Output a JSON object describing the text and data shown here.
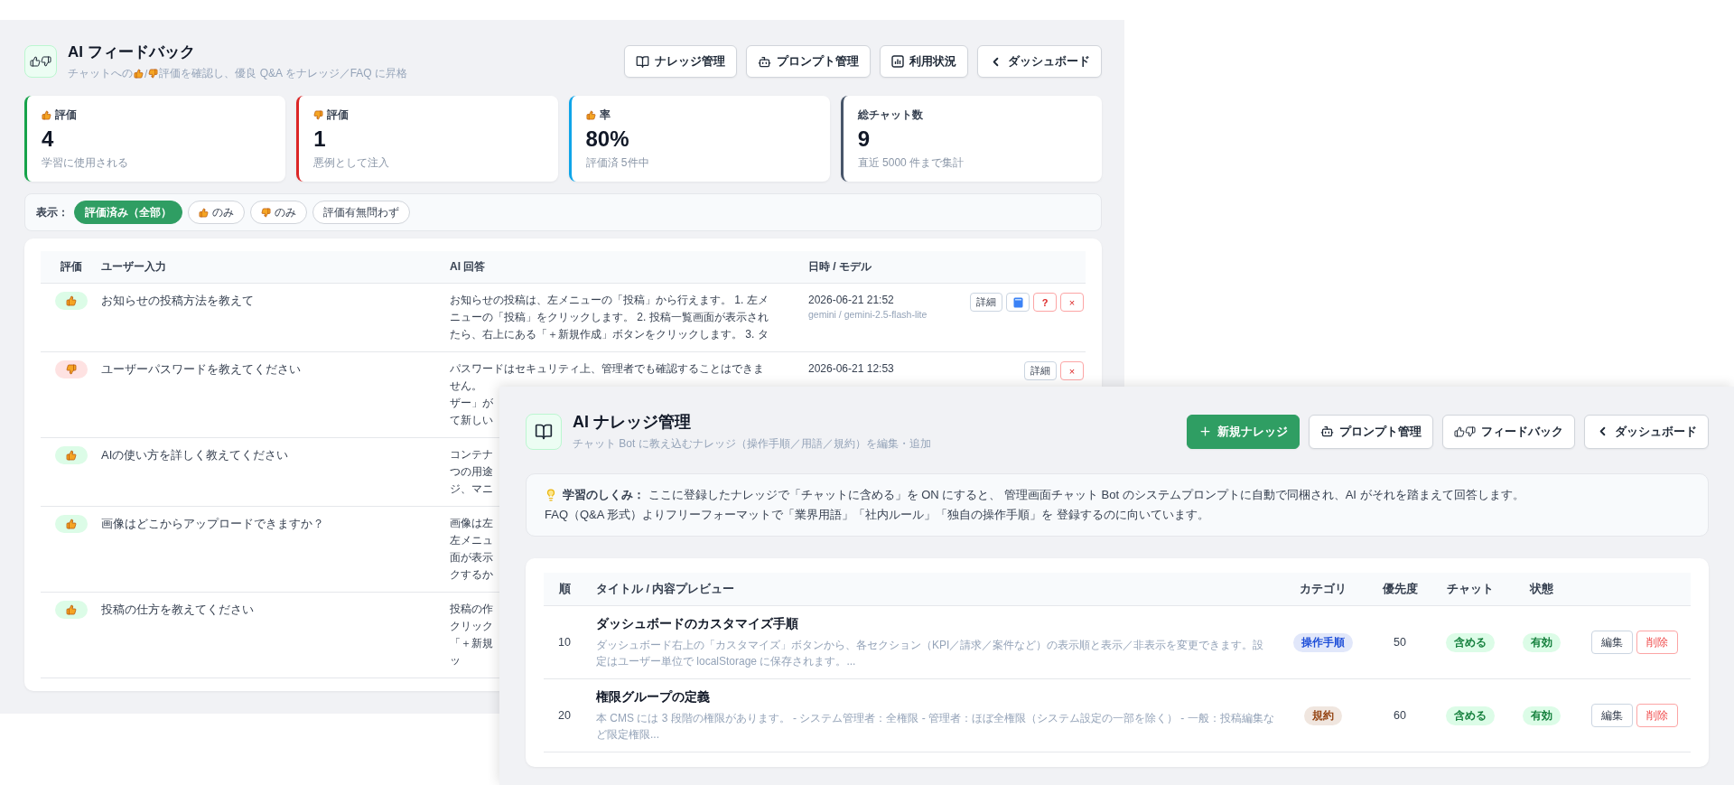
{
  "feedback_window": {
    "title": "AI フィードバック",
    "subtitle": {
      "before": "チャットへの",
      "between": "/",
      "after": "評価を確認し、優良 Q&A をナレッジ／FAQ に昇格"
    },
    "nav_buttons": [
      {
        "kind": "book",
        "label": "ナレッジ管理"
      },
      {
        "kind": "bot",
        "label": "プロンプト管理"
      },
      {
        "kind": "chart",
        "label": "利用状況"
      },
      {
        "kind": "back",
        "label": "ダッシュボード"
      }
    ],
    "stats": [
      {
        "kind": "positive",
        "label": "評価",
        "value": "4",
        "note": "学習に使用される",
        "color": "#16a34a"
      },
      {
        "kind": "negative",
        "label": "評価",
        "value": "1",
        "note": "悪例として注入",
        "color": "#dc2626"
      },
      {
        "kind": "positive",
        "label": "率",
        "value": "80%",
        "note": "評価済 5件中",
        "color": "#0ea5e9"
      },
      {
        "kind": "plain",
        "label": "総チャット数",
        "value": "9",
        "note": "直近 5000 件まで集計",
        "color": "#475569"
      }
    ],
    "filter": {
      "label": "表示：",
      "chips": [
        {
          "kind": "plain",
          "label": "評価済み（全部）",
          "selected": true
        },
        {
          "kind": "positive",
          "label": "のみ",
          "selected": false
        },
        {
          "kind": "negative",
          "label": "のみ",
          "selected": false
        },
        {
          "kind": "plain",
          "label": "評価有無問わず",
          "selected": false
        }
      ]
    },
    "table": {
      "columns": [
        "評価",
        "ユーザー入力",
        "AI 回答",
        "日時 / モデル"
      ],
      "rows": [
        {
          "positive": true,
          "question": "お知らせの投稿方法を教えて",
          "answer_lines": [
            "お知らせの投稿は、左メニューの「投稿」から行えます。 1. 左メ",
            "ニューの「投稿」をクリックします。 2. 投稿一覧画面が表示され",
            "たら、右上にある「＋新規作成」ボタンをクリックします。 3. タ"
          ],
          "date": "2026-06-21 21:52",
          "model": "gemini / gemini-2.5-flash-lite",
          "actions": [
            {
              "kind": "detail",
              "label": "詳細"
            },
            {
              "kind": "knowledge"
            },
            {
              "kind": "faq",
              "label": "?"
            },
            {
              "kind": "delete",
              "label": "×"
            }
          ]
        },
        {
          "positive": false,
          "question": "ユーザーパスワードを教えてください",
          "answer_lines": [
            "パスワードはセキュリティ上、管理者でも確認することはできま",
            "せん。",
            "ザー」が",
            "て新しい"
          ],
          "date": "2026-06-21 12:53",
          "actions": [
            {
              "kind": "detail",
              "label": "詳細"
            },
            {
              "kind": "delete",
              "label": "×"
            }
          ]
        },
        {
          "positive": true,
          "question": "AIの使い方を詳しく教えてください",
          "answer_lines": [
            "コンテナ",
            "つの用途",
            "ジ、マニ"
          ]
        },
        {
          "positive": true,
          "question": "画像はどこからアップロードできますか？",
          "answer_lines": [
            "画像は左",
            "左メニュ",
            "面が表示",
            "クするか"
          ]
        },
        {
          "positive": true,
          "question": "投稿の仕方を教えてください",
          "answer_lines": [
            "投稿の作",
            "クリック",
            "「＋新規",
            "ッ"
          ]
        }
      ]
    }
  },
  "knowledge_window": {
    "title": "AI ナレッジ管理",
    "subtitle": "チャット Bot に教え込むナレッジ（操作手順／用語／規約）を編集・追加",
    "nav_buttons": [
      {
        "kind": "add",
        "label": "新規ナレッジ"
      },
      {
        "kind": "bot",
        "label": "プロンプト管理"
      },
      {
        "kind": "feedback",
        "label": "フィードバック"
      },
      {
        "kind": "back",
        "label": "ダッシュボード"
      }
    ],
    "info_lines": [
      "**学習のしくみ：** ここに登録したナレッジで「チャットに含める」を ON にすると、 管理画面チャット Bot のシステムプロンプトに自動で同梱され、AI がそれを踏まえて回答します。",
      "FAQ（Q&A 形式）よりフリーフォーマットで「業界用語」「社内ルール」「独自の操作手順」を 登録するのに向いています。"
    ],
    "table": {
      "columns": [
        "順",
        "タイトル / 内容プレビュー",
        "カテゴリ",
        "優先度",
        "チャット",
        "状態"
      ],
      "rows": [
        {
          "order": "10",
          "title": "ダッシュボードのカスタマイズ手順",
          "preview": "ダッシュボード右上の「カスタマイズ」ボタンから、各セクション（KPI／請求／案件など）の表示順と表示／非表示を変更できます。設定はユーザー単位で localStorage に保存されます。...",
          "category": {
            "label": "操作手順",
            "color": "#1d4ed8"
          },
          "priority": "50",
          "chat": "含める",
          "status": "有効",
          "edit": "編集",
          "delete": "削除"
        },
        {
          "order": "20",
          "title": "権限グループの定義",
          "preview": "本 CMS には 3 段階の権限があります。 - システム管理者：全権限 - 管理者：ほぼ全権限（システム設定の一部を除く） - 一般：投稿編集など限定権限...",
          "category": {
            "label": "規約",
            "color": "#92400e"
          },
          "priority": "60",
          "chat": "含める",
          "status": "有効",
          "edit": "編集",
          "delete": "削除"
        }
      ]
    }
  }
}
